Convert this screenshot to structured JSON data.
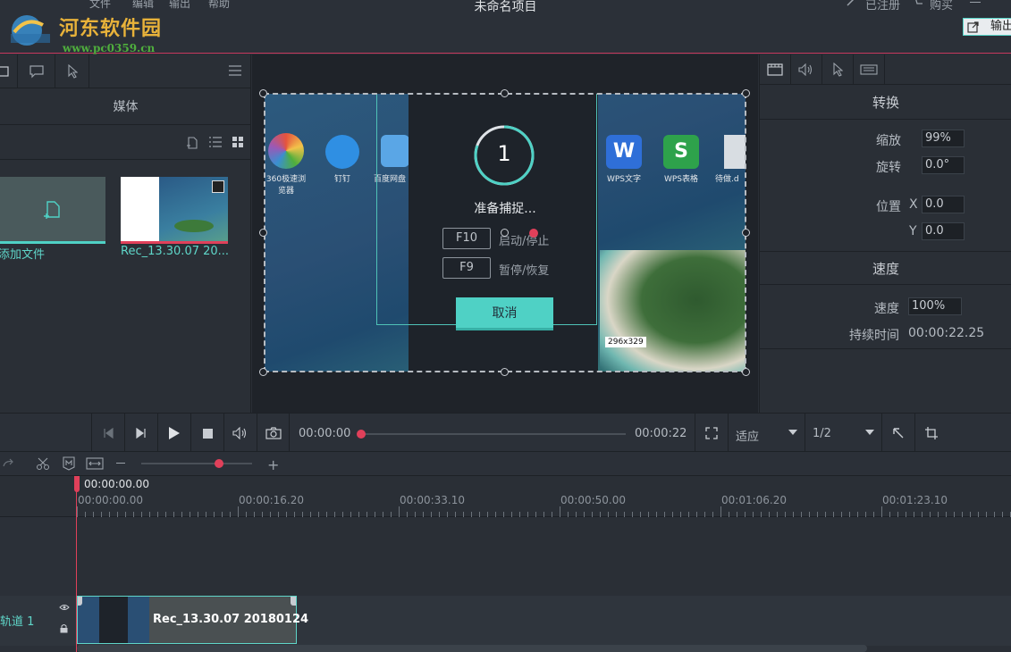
{
  "title_bar": {
    "menu": [
      "文件",
      "编辑",
      "输出",
      "帮助"
    ],
    "project_title": "未命名项目",
    "registered": "已注册",
    "buy": "购买",
    "export_label": "输出"
  },
  "watermark": {
    "text": "河东软件园",
    "url": "www.pc0359.cn"
  },
  "left_panel": {
    "section_title": "媒体",
    "add_file_label": "添加文件",
    "clip_label": "Rec_13.30.07 20..."
  },
  "capture_overlay": {
    "countdown": "1",
    "ready_text": "准备捕捉...",
    "hotkeys": [
      {
        "key": "F10",
        "action": "启动/停止"
      },
      {
        "key": "F9",
        "action": "暂停/恢复"
      }
    ],
    "cancel_label": "取消",
    "size_badge": "296x329"
  },
  "desktop_icons": [
    {
      "label": "360极速浏览器",
      "color": "#e5533d"
    },
    {
      "label": "钉钉",
      "color": "#2f8fe3"
    },
    {
      "label": "百度网盘",
      "color": "#5aa6e6"
    },
    {
      "label": "WPS文字",
      "color": "#2f6fd8"
    },
    {
      "label": "WPS表格",
      "color": "#2ea24b"
    },
    {
      "label": "待做.d",
      "color": "#d8dde2"
    }
  ],
  "right_panel": {
    "transform_title": "转换",
    "scale_label": "缩放",
    "scale_value": "99%",
    "rotate_label": "旋转",
    "rotate_value": "0.0°",
    "position_label": "位置",
    "x_label": "X",
    "x_value": "0.0",
    "y_label": "Y",
    "y_value": "0.0",
    "speed_title": "速度",
    "speed_label": "速度",
    "speed_value": "100%",
    "duration_label": "持续时间",
    "duration_value": "00:00:22.25"
  },
  "transport": {
    "current_time": "00:00:00",
    "total_time": "00:00:22",
    "fit_option": "适应",
    "quality_option": "1/2",
    "progress": 0.0
  },
  "timeline": {
    "playhead_time": "00:00:00.00",
    "ruler_labels": [
      "00:00:00.00",
      "00:00:16.20",
      "00:00:33.10",
      "00:00:50.00",
      "00:01:06.20",
      "00:01:23.10"
    ],
    "track_label": "轨道 1",
    "clip_name": "Rec_13.30.07 20180124",
    "zoom_level": 0.5
  },
  "colors": {
    "accent": "#4fd1c5",
    "playhead": "#e0405a",
    "watermark": "#e8b23a"
  }
}
